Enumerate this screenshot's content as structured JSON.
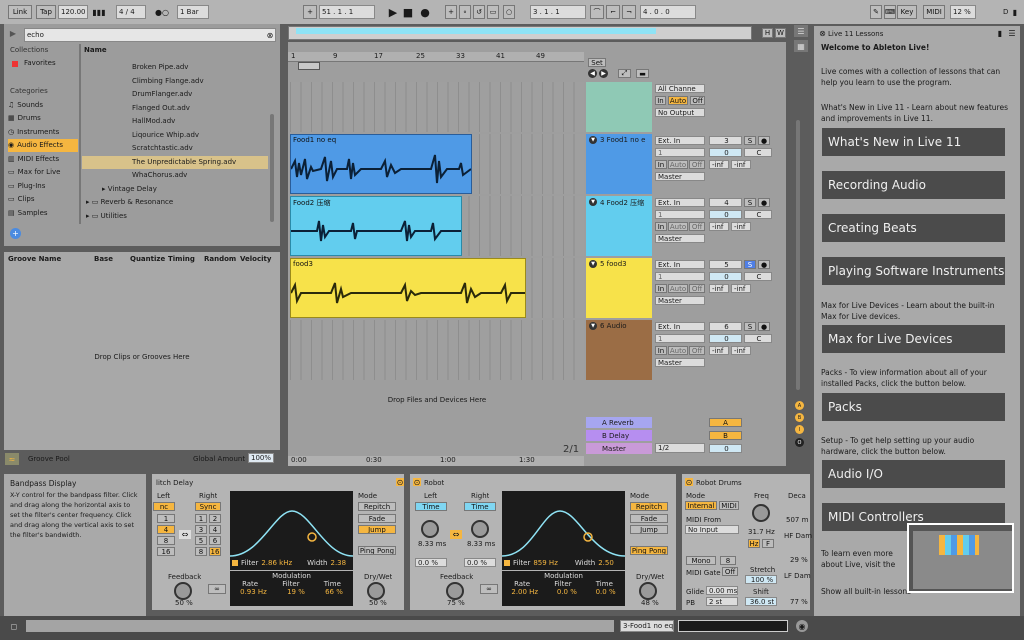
{
  "transport": {
    "link": "Link",
    "tap": "Tap",
    "tempo": "120.00",
    "sig": "4 / 4",
    "quant": "1 Bar",
    "position": "51 .   1 .   1",
    "loop_start": "3 .   1 .   1",
    "loop_len": "4 .   0 .   0",
    "key": "Key",
    "midi": "MIDI",
    "cpu": "12 %",
    "d": "D"
  },
  "browser": {
    "search": "echo",
    "collections_header": "Collections",
    "favorites": "Favorites",
    "categories_header": "Categories",
    "categories": [
      "Sounds",
      "Drums",
      "Instruments",
      "Audio Effects",
      "MIDI Effects",
      "Max for Live",
      "Plug-Ins",
      "Clips",
      "Samples"
    ],
    "name_header": "Name",
    "files": [
      "Broken Pipe.adv",
      "Climbing Flange.adv",
      "DrumFlanger.adv",
      "Flanged Out.adv",
      "HallMod.adv",
      "Liqourice Whip.adv",
      "Scratchtastic.adv",
      "The Unpredictable Spring.adv",
      "WhaChorus.adv"
    ],
    "folders": [
      "Vintage Delay",
      "Reverb & Resonance",
      "Utilities"
    ]
  },
  "groove": {
    "cols": [
      "Groove Name",
      "Base",
      "Quantize",
      "Timing",
      "Random",
      "Velocity"
    ],
    "drop": "Drop Clips or Grooves Here",
    "pool": "Groove Pool",
    "global_label": "Global Amount",
    "global_value": "100%"
  },
  "arrangement": {
    "ruler": [
      "1",
      "9",
      "17",
      "25",
      "33",
      "41",
      "49"
    ],
    "time": [
      "0:00",
      "0:30",
      "1:00",
      "1:30"
    ],
    "set_label": "Set",
    "drop": "Drop Files and Devices Here",
    "ratio": "2/1"
  },
  "clips": [
    {
      "name": "Food1 no eq",
      "color": "#4f9ae6"
    },
    {
      "name": "Food2 压缩",
      "color": "#62cdee"
    },
    {
      "name": "food3",
      "color": "#f7e24a"
    }
  ],
  "tracks": [
    {
      "name": "3 Food1 no e",
      "color": "#4f9ae6",
      "input": "Ext. In",
      "ch": "1",
      "num": "3",
      "out": "Master"
    },
    {
      "name": "4 Food2 压缩",
      "color": "#62cdee",
      "input": "Ext. In",
      "ch": "1",
      "num": "4",
      "out": "Master"
    },
    {
      "name": "5 food3",
      "color": "#f7e24a",
      "input": "Ext. In",
      "ch": "1",
      "num": "5",
      "out": "Master"
    },
    {
      "name": "6 Audio",
      "color": "#9b6d45",
      "input": "Ext. In",
      "ch": "1",
      "num": "6",
      "out": "Master"
    }
  ],
  "mixer": {
    "all_channels": "All Channe",
    "no_output": "No Output",
    "in": "In",
    "auto": "Auto",
    "off": "Off",
    "zero": "0",
    "c": "C",
    "inf": "-inf",
    "s": "S"
  },
  "returns": [
    {
      "name": "A Reverb",
      "btn": "A"
    },
    {
      "name": "B Delay",
      "btn": "B"
    },
    {
      "name": "Master",
      "btn": "0"
    }
  ],
  "master_ratio": "1/2",
  "lessons": {
    "title": "Live 11 Lessons",
    "welcome": "Welcome to Ableton Live!",
    "intro": "Live comes with a collection of lessons that can help you learn to use the program.",
    "whatsnew_text": "What's New in Live 11 - Learn about new features and improvements in Live 11.",
    "buttons": [
      "What's New in Live 11",
      "Recording Audio",
      "Creating Beats",
      "Playing Software Instruments",
      "Max for Live Devices",
      "Packs",
      "Audio I/O",
      "MIDI Controllers"
    ],
    "m4l_text": "Max for Live Devices - Learn about the built-in Max for Live devices.",
    "packs_text": "Packs - To view information about all of your installed Packs, click the button below.",
    "setup_text": "Setup - To get help setting up your audio hardware, click the button below.",
    "more": "To learn even more about Live, visit the Ableton Reference Manual.",
    "show": "Show all built-in lessons"
  },
  "info": {
    "title": "Bandpass Display",
    "text": "X-Y control for the bandpass filter. Click and drag along the horizontal axis to set the filter's center frequency. Click and drag along the vertical axis to set the filter's bandwidth."
  },
  "device1": {
    "name": "litch Delay",
    "left": "Left",
    "right": "Right",
    "sync": "Sync",
    "lnums": [
      "nc",
      "1",
      "4",
      "8",
      "16"
    ],
    "rnums": [
      "Sync",
      "1",
      "3",
      "8",
      "16"
    ],
    "rnums2": [
      "2",
      "5",
      "6"
    ],
    "mode": "Mode",
    "repitch": "Repitch",
    "fade": "Fade",
    "jump": "Jump",
    "pingpong": "Ping Pong",
    "filter_label": "Filter",
    "filter": "2.86 kHz",
    "width_label": "Width",
    "width": "2.38",
    "modulation": "Modulation",
    "rate_l": "Rate",
    "filter_l": "Filter",
    "time_l": "Time",
    "rate": "0.93 Hz",
    "filt": "19 %",
    "time": "66 %",
    "feedback": "Feedback",
    "fb": "50 %",
    "drywet": "Dry/Wet",
    "dw": "50 %",
    "inf": "∞"
  },
  "device2": {
    "name": "Robot",
    "left": "Left",
    "right": "Right",
    "time": "Time",
    "lms": "8.33 ms",
    "rms": "8.33 ms",
    "lpct": "0.0 %",
    "rpct": "0.0 %",
    "mode": "Mode",
    "repitch": "Repitch",
    "fade": "Fade",
    "jump": "Jump",
    "pingpong": "Ping Pong",
    "filter_label": "Filter",
    "filter": "859 Hz",
    "width_label": "Width",
    "width": "2.50",
    "modulation": "Modulation",
    "rate_l": "Rate",
    "filter_l": "Filter",
    "time_l": "Time",
    "rate": "2.00 Hz",
    "filt": "0.0 %",
    "tim": "0.0 %",
    "feedback": "Feedback",
    "fb": "75 %",
    "drywet": "Dry/Wet",
    "dw": "48 %",
    "inf": "∞"
  },
  "device3": {
    "name": "Robot Drums",
    "mode": "Mode",
    "internal": "Internal",
    "midi": "MIDI",
    "midifrom": "MIDI From",
    "noinput": "No Input",
    "mono": "Mono",
    "eight": "8",
    "midigate": "MIDI Gate",
    "off": "Off",
    "glide": "Glide",
    "glidev": "0.00 ms",
    "pb": "PB",
    "pbv": "2 st",
    "freq": "Freq",
    "freqv": "31.7 Hz",
    "hz": "Hz",
    "f": "F",
    "stretch": "Stretch",
    "stretchv": "100 %",
    "shift": "Shift",
    "shiftv": "36.0 st",
    "deca": "Deca",
    "decav": "507 m",
    "hfdam": "HF Dam",
    "hfv": "29 %",
    "lfdam": "LF Dam",
    "lfv": "77 %"
  },
  "status": {
    "track": "3-Food1 no eq"
  }
}
